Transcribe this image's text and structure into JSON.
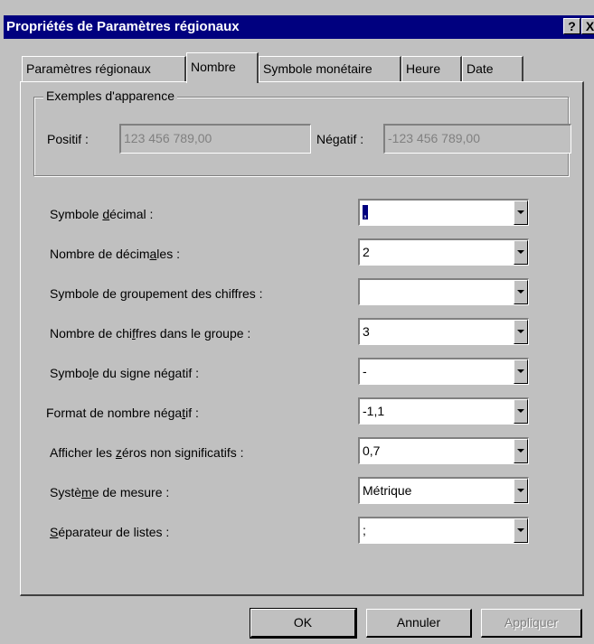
{
  "window": {
    "title": "Propriétés de Paramètres régionaux",
    "help_label": "?",
    "close_label": "X"
  },
  "tabs": [
    {
      "label": "Paramètres régionaux",
      "active": false
    },
    {
      "label": "Nombre",
      "active": true
    },
    {
      "label": "Symbole monétaire",
      "active": false
    },
    {
      "label": "Heure",
      "active": false
    },
    {
      "label": "Date",
      "active": false
    }
  ],
  "examples": {
    "legend": "Exemples d'apparence",
    "positive_label": "Positif :",
    "positive_value": "123 456 789,00",
    "negative_label": "Négatif :",
    "negative_value": "-123 456 789,00"
  },
  "settings": [
    {
      "label": "Symbole décimal :",
      "value": ",",
      "selected": true
    },
    {
      "label": "Nombre de décimales :",
      "value": "2"
    },
    {
      "label": "Symbole de groupement des chiffres :",
      "value": ""
    },
    {
      "label": "Nombre de chiffres dans le groupe :",
      "value": "3"
    },
    {
      "label": "Symbole du signe négatif :",
      "value": "-"
    },
    {
      "label": "Format de nombre négatif :",
      "value": "-1,1"
    },
    {
      "label": "Afficher les zéros non significatifs :",
      "value": "0,7"
    },
    {
      "label": "Système de mesure :",
      "value": "Métrique"
    },
    {
      "label": "Séparateur de listes :",
      "value": ";"
    }
  ],
  "buttons": {
    "ok": "OK",
    "cancel": "Annuler",
    "apply": "Appliquer"
  }
}
